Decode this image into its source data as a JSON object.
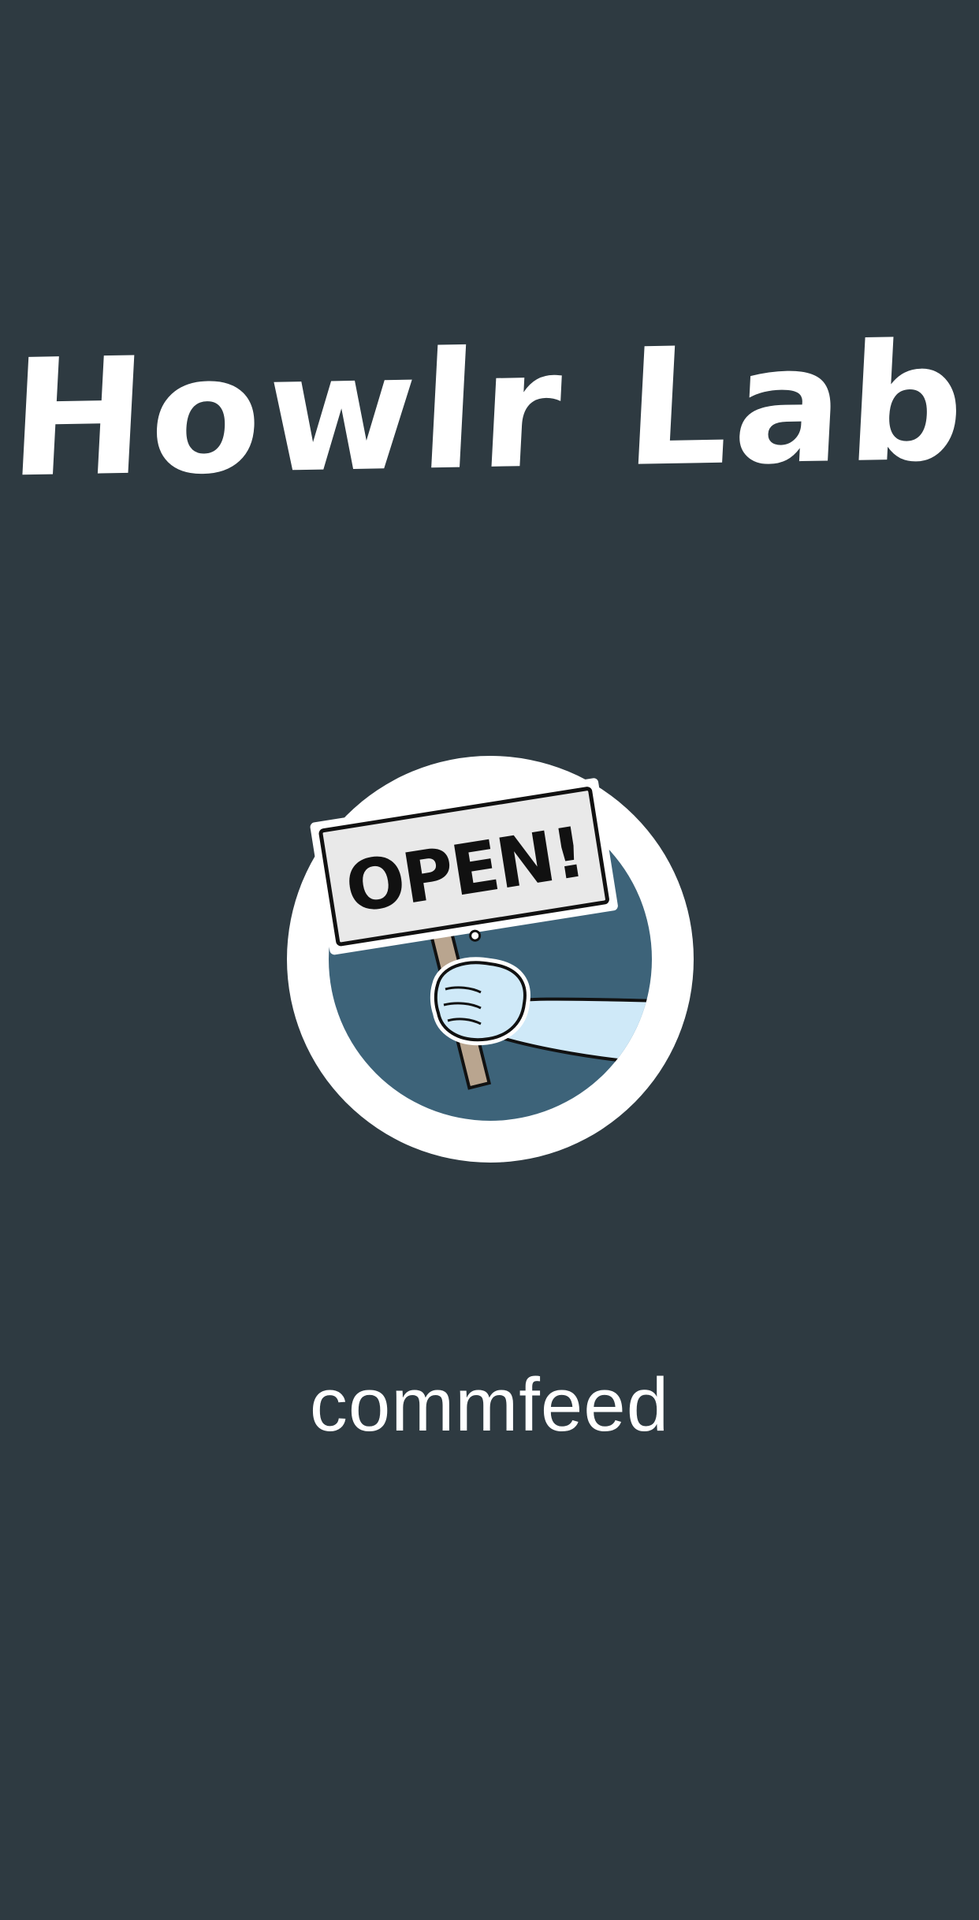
{
  "splash": {
    "brand_title": "Howlr Lab",
    "app_name": "commfeed",
    "logo": {
      "icon": "open-sign-hand-icon",
      "sign_text": "OPEN!"
    }
  },
  "colors": {
    "background": "#2e3a41",
    "logo_ring": "#ffffff",
    "logo_disc": "#3d6379",
    "hand": "#cfe9f8",
    "sign": "#e9e9e9",
    "text": "#ffffff"
  }
}
